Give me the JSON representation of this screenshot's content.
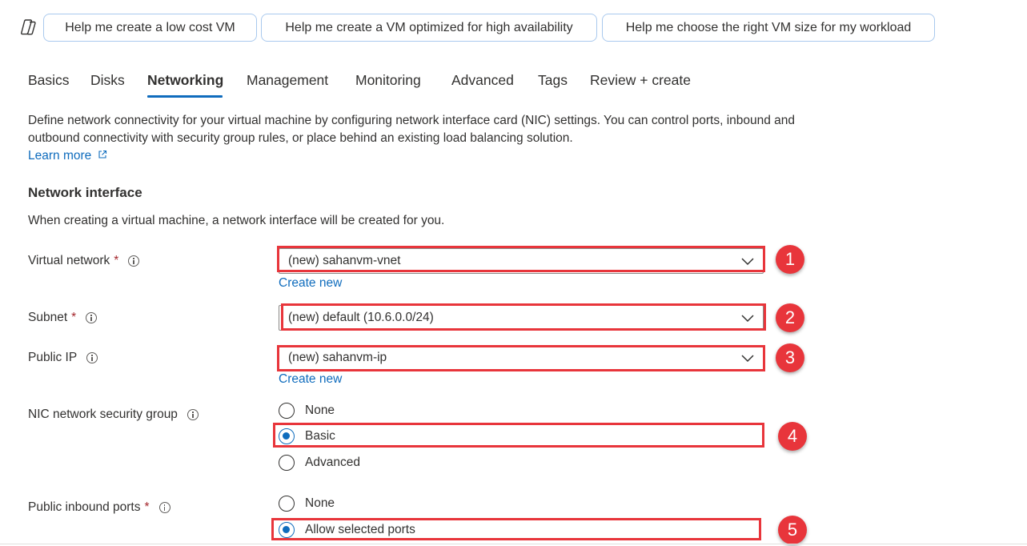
{
  "copilot": {
    "icon": "copilot-icon",
    "suggestions": [
      "Help me create a low cost VM",
      "Help me create a VM optimized for high availability",
      "Help me choose the right VM size for my workload"
    ]
  },
  "tabs": [
    "Basics",
    "Disks",
    "Networking",
    "Management",
    "Monitoring",
    "Advanced",
    "Tags",
    "Review + create"
  ],
  "active_tab": "Networking",
  "description": "Define network connectivity for your virtual machine by configuring network interface card (NIC) settings. You can control ports, inbound and outbound connectivity with security group rules, or place behind an existing load balancing solution.",
  "learn_more": "Learn more",
  "network_interface": {
    "title": "Network interface",
    "subtitle": "When creating a virtual machine, a network interface will be created for you."
  },
  "fields": {
    "virtual_network": {
      "label": "Virtual network",
      "required": "*",
      "value": "(new) sahanvm-vnet",
      "create_new": "Create new"
    },
    "subnet": {
      "label": "Subnet",
      "required": "*",
      "value": "(new) default (10.6.0.0/24)"
    },
    "public_ip": {
      "label": "Public IP",
      "value": "(new) sahanvm-ip",
      "create_new": "Create new"
    },
    "nic_nsg": {
      "label": "NIC network security group",
      "options": [
        "None",
        "Basic",
        "Advanced"
      ],
      "selected": "Basic"
    },
    "public_inbound_ports": {
      "label": "Public inbound ports",
      "required": "*",
      "options": [
        "None",
        "Allow selected ports"
      ],
      "selected": "Allow selected ports"
    }
  },
  "annotations": [
    "1",
    "2",
    "3",
    "4",
    "5"
  ],
  "colors": {
    "accent": "#0f6cbd",
    "highlight": "#e8353b",
    "required": "#a4262c"
  }
}
